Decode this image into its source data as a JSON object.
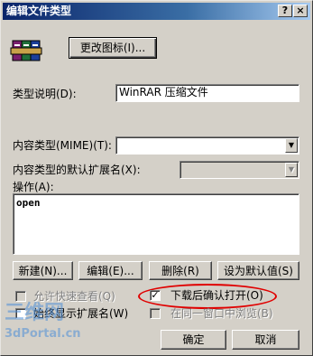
{
  "window": {
    "title": "编辑文件类型",
    "help_button": "?",
    "close_button": "×"
  },
  "icon_button": {
    "label": "更改图标(I)..."
  },
  "description": {
    "label": "类型说明(D):",
    "value": "WinRAR 压缩文件"
  },
  "content_type": {
    "label": "内容类型(MIME)(T):",
    "value": ""
  },
  "default_ext": {
    "label": "内容类型的默认扩展名(X):",
    "value": ""
  },
  "actions": {
    "label": "操作(A):",
    "items": [
      "open"
    ]
  },
  "action_buttons": {
    "new": "新建(N)...",
    "edit": "编辑(E)...",
    "remove": "删除(R)",
    "set_default": "设为默认值(S)"
  },
  "options": {
    "quick_view": {
      "label": "允许快速查看(Q)",
      "checked": false,
      "disabled": true
    },
    "confirm_open": {
      "label": "下载后确认打开(O)",
      "checked": true
    },
    "always_show_ext": {
      "label": "始终显示扩展名(W)",
      "checked": false
    },
    "same_window": {
      "label": "在同一窗口中浏览(B)",
      "checked": false,
      "disabled": true
    }
  },
  "footer": {
    "ok": "确定",
    "cancel": "取消"
  },
  "watermark": {
    "line1": "三维网",
    "line2": "3dPortal.cn"
  },
  "colors": {
    "highlight": "#e00000",
    "title_bar": "#0a246a"
  },
  "icons": {
    "app_icon": "winrar-archive-icon"
  }
}
